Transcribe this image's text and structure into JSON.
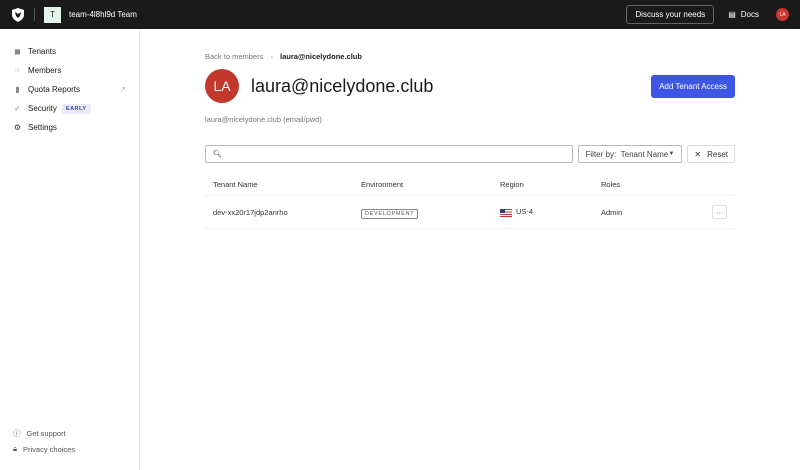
{
  "topbar": {
    "team_initial": "T",
    "team_name": "team-4l8hl9d Team",
    "discuss": "Discuss your needs",
    "docs": "Docs",
    "user_initials": "LA"
  },
  "sidebar": {
    "items": [
      {
        "label": "Tenants"
      },
      {
        "label": "Members"
      },
      {
        "label": "Quota Reports"
      },
      {
        "label": "Security",
        "badge": "EARLY"
      },
      {
        "label": "Settings"
      }
    ],
    "support": "Get support",
    "privacy": "Privacy choices"
  },
  "main": {
    "breadcrumb_back": "Back to members",
    "breadcrumb_current": "laura@nicelydone.club",
    "avatar": "LA",
    "title": "laura@nicelydone.club",
    "add_button": "Add Tenant Access",
    "subtitle": "laura@nicelydone.club (email/pwd)",
    "search_placeholder": "",
    "filter_label": "Filter by:",
    "filter_value": "Tenant Name",
    "reset": "Reset",
    "columns": [
      "Tenant Name",
      "Environment",
      "Region",
      "Roles"
    ],
    "rows": [
      {
        "tenant": "dev-xx20r17jdp2anrho",
        "environment": "DEVELOPMENT",
        "region": "US-4",
        "role": "Admin"
      }
    ]
  },
  "colors": {
    "accent": "#3e56e5",
    "avatar": "#c0392b",
    "topbar": "#1a1a1a"
  }
}
